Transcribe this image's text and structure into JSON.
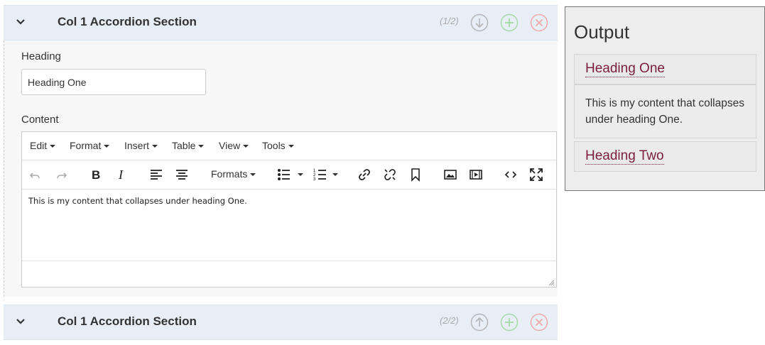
{
  "sections": [
    {
      "title": "Col 1 Accordion Section",
      "counter": "(1/2)",
      "move_icon": "arrow-down-circle-icon",
      "expanded": true
    },
    {
      "title": "Col 1 Accordion Section",
      "counter": "(2/2)",
      "move_icon": "arrow-up-circle-icon",
      "expanded": false
    }
  ],
  "form": {
    "heading_label": "Heading",
    "heading_value": "Heading One",
    "content_label": "Content"
  },
  "editor": {
    "menus": [
      "Edit",
      "Format",
      "Insert",
      "Table",
      "View",
      "Tools"
    ],
    "formats_label": "Formats",
    "content": "This is my content that collapses under heading One.",
    "toolbar_icons": [
      "undo-icon",
      "redo-icon",
      "bold-icon",
      "italic-icon",
      "align-left-icon",
      "align-center-icon",
      "bullet-list-icon",
      "numbered-list-icon",
      "link-icon",
      "unlink-icon",
      "bookmark-icon",
      "image-icon",
      "media-icon",
      "code-icon",
      "fullscreen-icon"
    ]
  },
  "output": {
    "title": "Output",
    "items": [
      {
        "heading": "Heading One",
        "content": "This is my content that collapses under heading One."
      },
      {
        "heading": "Heading Two"
      }
    ]
  },
  "colors": {
    "section_header_bg": "#e7eef6",
    "link": "#7a1e3c",
    "add_green": "#a6d9a6",
    "delete_red": "#f0a9a9",
    "move_gray": "#b5b5b5"
  }
}
